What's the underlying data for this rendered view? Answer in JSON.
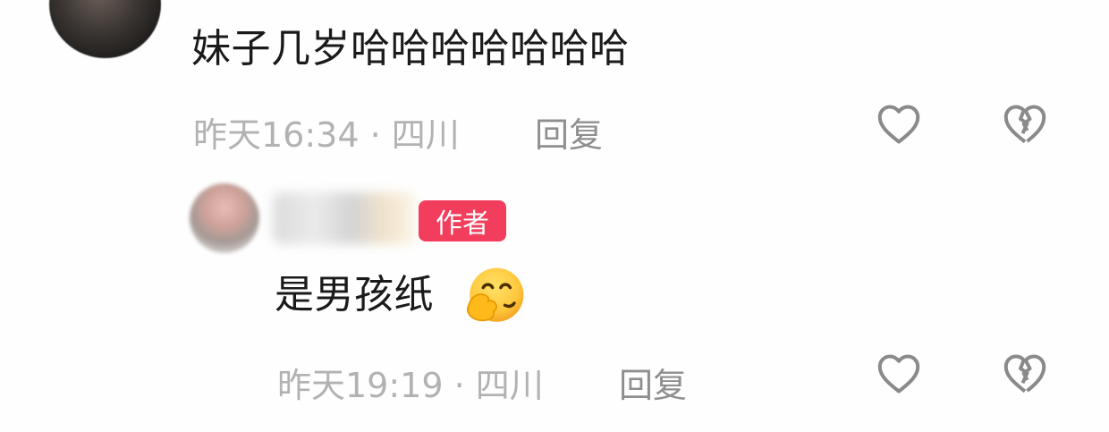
{
  "comments": [
    {
      "text": "妹子几岁哈哈哈哈哈哈哈",
      "meta": "昨天16:34 · 四川",
      "reply_label": "回复"
    },
    {
      "author_badge": "作者",
      "text": "是男孩纸",
      "emoji": "face-with-hand-over-mouth",
      "meta": "昨天19:19 · 四川",
      "reply_label": "回复"
    }
  ],
  "icons": {
    "like": "heart-outline-icon",
    "dislike": "broken-heart-icon"
  }
}
